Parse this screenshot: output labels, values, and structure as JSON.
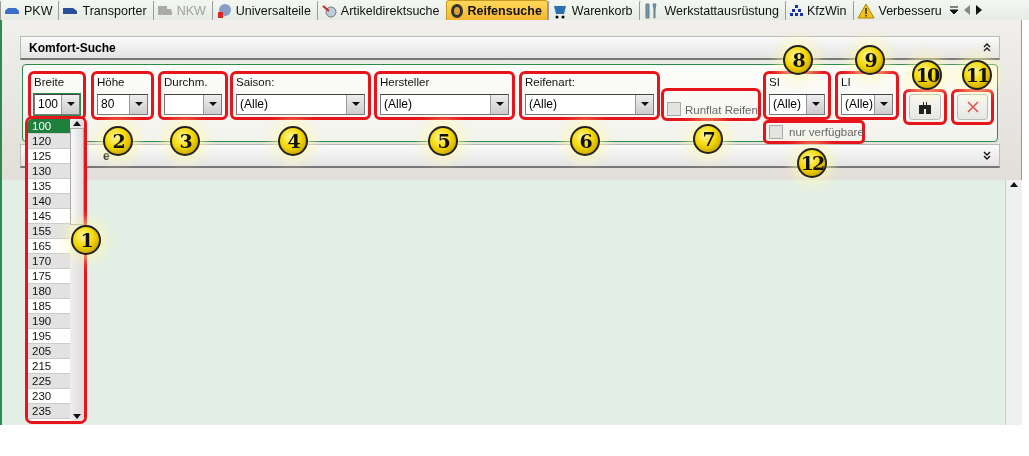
{
  "tabs": [
    {
      "label": "PKW",
      "selected": false,
      "disabled": false
    },
    {
      "label": "Transporter",
      "selected": false,
      "disabled": false
    },
    {
      "label": "NKW",
      "selected": false,
      "disabled": true
    },
    {
      "label": "Universalteile",
      "selected": false,
      "disabled": false
    },
    {
      "label": "Artikeldirektsuche",
      "selected": false,
      "disabled": false
    },
    {
      "label": "Reifensuche",
      "selected": true,
      "disabled": false
    },
    {
      "label": "Warenkorb",
      "selected": false,
      "disabled": false
    },
    {
      "label": "Werkstattausrüstung",
      "selected": false,
      "disabled": false
    },
    {
      "label": "KfzWin",
      "selected": false,
      "disabled": false
    },
    {
      "label": "Verbesseru",
      "selected": false,
      "disabled": false
    }
  ],
  "komfort_suche": {
    "title": "Komfort-Suche",
    "expanded": true
  },
  "filters": [
    {
      "kind": "combo",
      "label": "Breite",
      "value": "100",
      "expanded": true
    },
    {
      "kind": "combo",
      "label": "Höhe",
      "value": "80",
      "expanded": false
    },
    {
      "kind": "combo",
      "label": "Durchm.",
      "expanded": false
    },
    {
      "kind": "combo",
      "label": "Saison:",
      "value": "(Alle)",
      "expanded": false
    },
    {
      "kind": "combo",
      "label": "Hersteller",
      "value": "(Alle)",
      "expanded": false
    },
    {
      "kind": "combo",
      "label": "Reifenart:",
      "value": "(Alle)",
      "expanded": false
    },
    {
      "kind": "checkbox",
      "label": "Runflat Reifen",
      "checked": false
    },
    {
      "kind": "combo",
      "label": "SI",
      "value": "(Alle)",
      "expanded": false
    },
    {
      "kind": "combo",
      "label": "LI",
      "value": "(Alle)",
      "expanded": false
    },
    {
      "kind": "button"
    },
    {
      "kind": "button"
    }
  ],
  "nur_verfuegbare": {
    "label": "nur verfügbare",
    "checked": false
  },
  "breite_options": [
    {
      "label": "100",
      "selected": true
    },
    {
      "label": "120",
      "selected": false
    },
    {
      "label": "125",
      "selected": false
    },
    {
      "label": "130",
      "selected": false
    },
    {
      "label": "135",
      "selected": false
    },
    {
      "label": "140",
      "selected": false
    },
    {
      "label": "145",
      "selected": false
    },
    {
      "label": "155",
      "selected": false
    },
    {
      "label": "165",
      "selected": false
    },
    {
      "label": "170",
      "selected": false
    },
    {
      "label": "175",
      "selected": false
    },
    {
      "label": "180",
      "selected": false
    },
    {
      "label": "185",
      "selected": false
    },
    {
      "label": "190",
      "selected": false
    },
    {
      "label": "195",
      "selected": false
    },
    {
      "label": "205",
      "selected": false
    },
    {
      "label": "215",
      "selected": false
    },
    {
      "label": "225",
      "selected": false
    },
    {
      "label": "230",
      "selected": false
    },
    {
      "label": "235",
      "selected": false
    }
  ],
  "second_section": {
    "title": "e",
    "expanded": false
  },
  "callouts": [
    "1",
    "2",
    "3",
    "4",
    "5",
    "6",
    "7",
    "8",
    "9",
    "10",
    "11",
    "12"
  ]
}
